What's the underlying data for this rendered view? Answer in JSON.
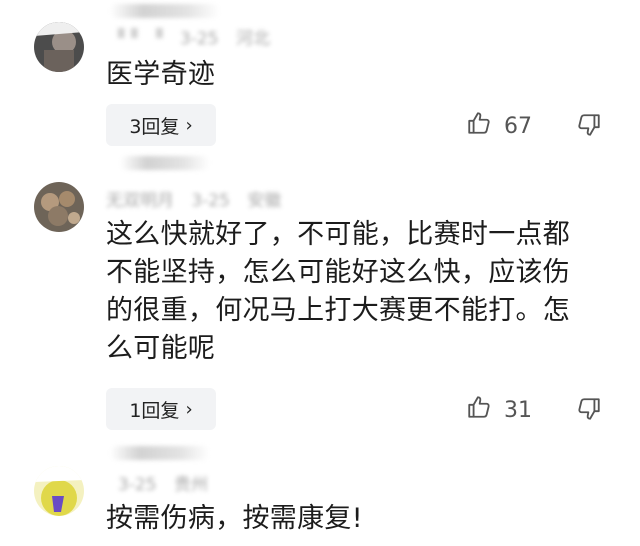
{
  "comments": [
    {
      "username": "",
      "date": "3-25",
      "location": "河北",
      "text": "医学奇迹",
      "reply_label": "3回复",
      "likes": "67",
      "avatar_color": "#5a5a5a"
    },
    {
      "username": "无双明月",
      "date": "3-25",
      "location": "安徽",
      "text": "这么快就好了，不可能，比赛时一点都不能坚持，怎么可能好这么快，应该伤的很重，何况马上打大赛更不能打。怎么可能呢",
      "reply_label": "1回复",
      "likes": "31",
      "avatar_color": "#8a7a6a"
    },
    {
      "username": "",
      "date": "3-25",
      "location": "贵州",
      "text": "按需伤病，按需康复!",
      "avatar_color": "#d8d24a"
    }
  ],
  "icons": {
    "like": "thumbs-up-icon",
    "dislike": "thumbs-down-icon",
    "chevron": "chevron-right-icon"
  }
}
